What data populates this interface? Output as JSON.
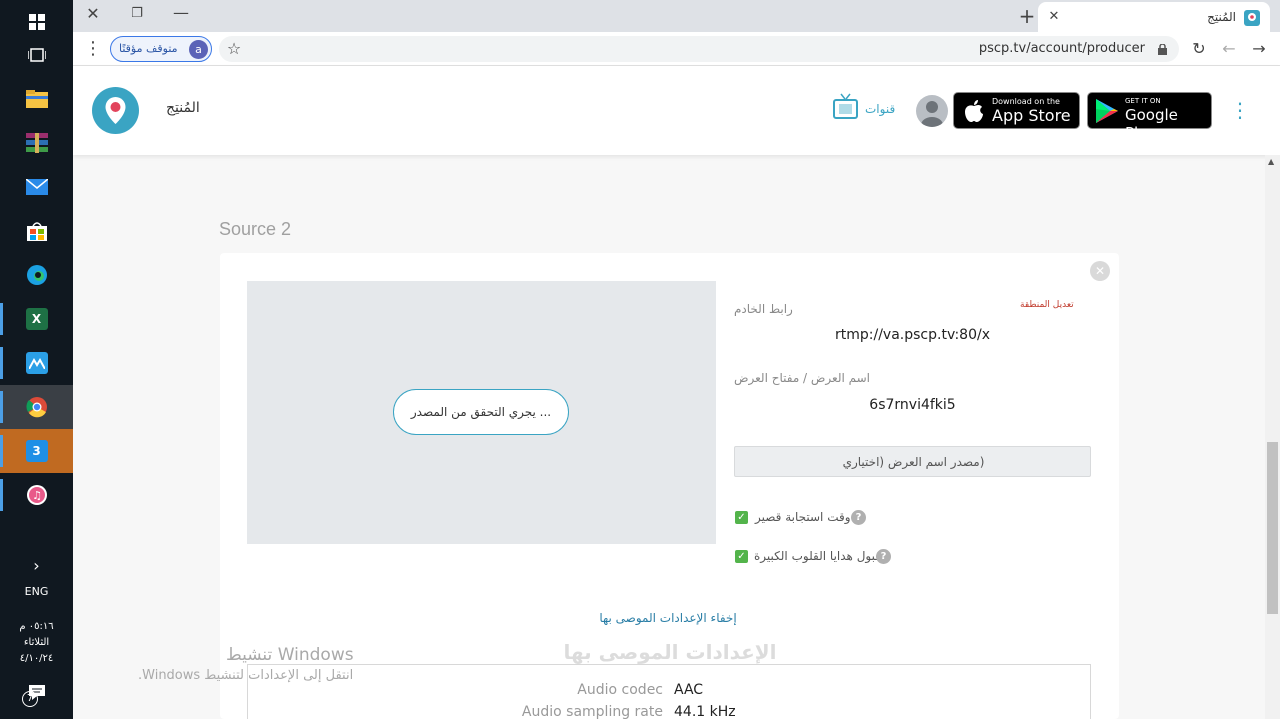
{
  "taskbar": {
    "apps": [
      {
        "name": "windows-start-icon",
        "color": "#ffffff",
        "glyph": "⊞"
      },
      {
        "name": "task-view-icon",
        "color": "#ffffff",
        "glyph": "⧉"
      },
      {
        "name": "file-explorer-icon",
        "color": "#f6c343",
        "glyph": ""
      },
      {
        "name": "winrar-icon",
        "color": "#9b2e6d",
        "glyph": ""
      },
      {
        "name": "mail-icon",
        "color": "#2a8ae8",
        "glyph": "✉"
      },
      {
        "name": "store-icon",
        "color": "#ffffff",
        "glyph": ""
      },
      {
        "name": "edge-icon",
        "color": "#1ba1e2",
        "glyph": ""
      },
      {
        "name": "excel-icon",
        "color": "#1e7145",
        "glyph": "x"
      },
      {
        "name": "app-icon",
        "color": "#2b9fe6",
        "glyph": ""
      },
      {
        "name": "chrome-icon",
        "color": "#dd4b39",
        "glyph": ""
      },
      {
        "name": "app-3-icon",
        "color": "#1e8fe6",
        "glyph": "3"
      },
      {
        "name": "itunes-icon",
        "color": "#e95a8a",
        "glyph": "♫"
      }
    ],
    "lang": "ENG",
    "time": "٠٥:١٦ م",
    "day": "الثلاثاء",
    "date": "٤/١٠/٢٤"
  },
  "browser": {
    "tab_title": "المُنتِج",
    "url": "pscp.tv/account/producer",
    "profile_letter": "a",
    "profile_status": "متوقف مؤقتًا"
  },
  "header": {
    "page_title": "المُنتِج",
    "channels_label": "قنوات",
    "appstore_small": "Download on the",
    "appstore_big": "App Store",
    "googleplay_small": "GET IT ON",
    "googleplay_big": "Google Play"
  },
  "source": {
    "title": "Source 2",
    "checking_label": "... يجري التحقق من المصدر",
    "edit_region_label": "تعديل المنطقة",
    "server_url_label": "رابط الخادم",
    "server_url": "rtmp://va.pscp.tv:80/x",
    "stream_key_label": "اسم العرض / مفتاح العرض",
    "stream_key": "6s7rnvi4fki5",
    "source_name_placeholder": "(مصدر اسم العرض (اختياري",
    "low_latency_label": "وقت استجابة قصير",
    "super_hearts_label": "قبول هدايا القلوب الكبيرة",
    "hide_settings_link": "إخفاء الإعدادات الموصى بها",
    "recommended_title": "الإعدادات الموصى بها",
    "specs": [
      {
        "key": "Audio codec",
        "value": "AAC"
      },
      {
        "key": "Audio sampling rate",
        "value": "44.1 kHz"
      }
    ]
  },
  "watermark": {
    "title": "تنشيط Windows",
    "subtitle": "انتقل إلى الإعدادات لتنشيط Windows."
  },
  "colors": {
    "accent": "#3aa4c3",
    "checkbox": "#53b44b",
    "edit_red": "#c0392b"
  }
}
